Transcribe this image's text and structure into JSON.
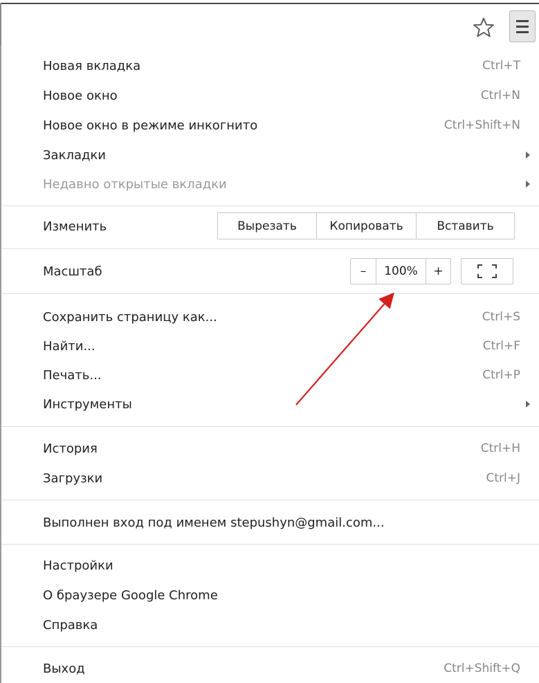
{
  "toolbar": {
    "bookmark_icon": "star-outline-icon",
    "menu_icon": "hamburger-menu-icon"
  },
  "menu": {
    "new_tab": {
      "label": "Новая вкладка",
      "shortcut": "Ctrl+T"
    },
    "new_window": {
      "label": "Новое окно",
      "shortcut": "Ctrl+N"
    },
    "incognito": {
      "label": "Новое окно в режиме инкогнито",
      "shortcut": "Ctrl+Shift+N"
    },
    "bookmarks": {
      "label": "Закладки"
    },
    "recent_tabs": {
      "label": "Недавно открытые вкладки"
    },
    "edit": {
      "label": "Изменить",
      "cut": "Вырезать",
      "copy": "Копировать",
      "paste": "Вставить"
    },
    "zoom": {
      "label": "Масштаб",
      "minus": "–",
      "value": "100%",
      "plus": "+"
    },
    "save_page": {
      "label": "Сохранить страницу как...",
      "shortcut": "Ctrl+S"
    },
    "find": {
      "label": "Найти...",
      "shortcut": "Ctrl+F"
    },
    "print": {
      "label": "Печать...",
      "shortcut": "Ctrl+P"
    },
    "tools": {
      "label": "Инструменты"
    },
    "history": {
      "label": "История",
      "shortcut": "Ctrl+H"
    },
    "downloads": {
      "label": "Загрузки",
      "shortcut": "Ctrl+J"
    },
    "signed_in": {
      "label": "Выполнен вход под именем stepushyn@gmail.com..."
    },
    "settings": {
      "label": "Настройки"
    },
    "about": {
      "label": "О браузере Google Chrome"
    },
    "help": {
      "label": "Справка"
    },
    "exit": {
      "label": "Выход",
      "shortcut": "Ctrl+Shift+Q"
    }
  },
  "colors": {
    "annotation_arrow": "#d42020",
    "shortcut_text": "#888888",
    "disabled_text": "#9a9a9a"
  }
}
